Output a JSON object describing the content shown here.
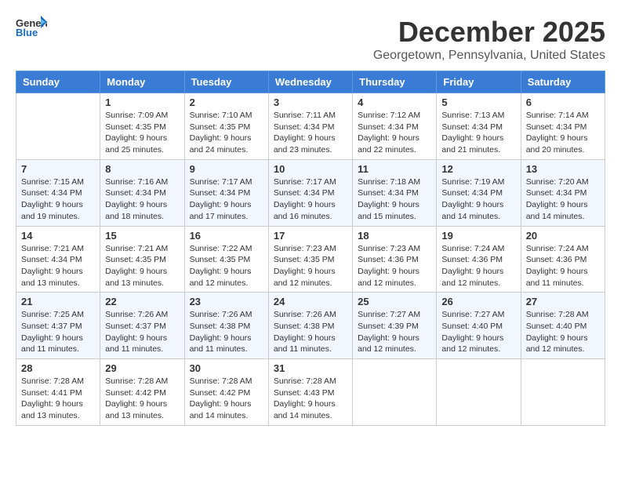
{
  "logo": {
    "general": "General",
    "blue": "Blue"
  },
  "title": "December 2025",
  "location": "Georgetown, Pennsylvania, United States",
  "days_of_week": [
    "Sunday",
    "Monday",
    "Tuesday",
    "Wednesday",
    "Thursday",
    "Friday",
    "Saturday"
  ],
  "weeks": [
    [
      {
        "day": "",
        "sunrise": "",
        "sunset": "",
        "daylight": ""
      },
      {
        "day": "1",
        "sunrise": "Sunrise: 7:09 AM",
        "sunset": "Sunset: 4:35 PM",
        "daylight": "Daylight: 9 hours and 25 minutes."
      },
      {
        "day": "2",
        "sunrise": "Sunrise: 7:10 AM",
        "sunset": "Sunset: 4:35 PM",
        "daylight": "Daylight: 9 hours and 24 minutes."
      },
      {
        "day": "3",
        "sunrise": "Sunrise: 7:11 AM",
        "sunset": "Sunset: 4:34 PM",
        "daylight": "Daylight: 9 hours and 23 minutes."
      },
      {
        "day": "4",
        "sunrise": "Sunrise: 7:12 AM",
        "sunset": "Sunset: 4:34 PM",
        "daylight": "Daylight: 9 hours and 22 minutes."
      },
      {
        "day": "5",
        "sunrise": "Sunrise: 7:13 AM",
        "sunset": "Sunset: 4:34 PM",
        "daylight": "Daylight: 9 hours and 21 minutes."
      },
      {
        "day": "6",
        "sunrise": "Sunrise: 7:14 AM",
        "sunset": "Sunset: 4:34 PM",
        "daylight": "Daylight: 9 hours and 20 minutes."
      }
    ],
    [
      {
        "day": "7",
        "sunrise": "Sunrise: 7:15 AM",
        "sunset": "Sunset: 4:34 PM",
        "daylight": "Daylight: 9 hours and 19 minutes."
      },
      {
        "day": "8",
        "sunrise": "Sunrise: 7:16 AM",
        "sunset": "Sunset: 4:34 PM",
        "daylight": "Daylight: 9 hours and 18 minutes."
      },
      {
        "day": "9",
        "sunrise": "Sunrise: 7:17 AM",
        "sunset": "Sunset: 4:34 PM",
        "daylight": "Daylight: 9 hours and 17 minutes."
      },
      {
        "day": "10",
        "sunrise": "Sunrise: 7:17 AM",
        "sunset": "Sunset: 4:34 PM",
        "daylight": "Daylight: 9 hours and 16 minutes."
      },
      {
        "day": "11",
        "sunrise": "Sunrise: 7:18 AM",
        "sunset": "Sunset: 4:34 PM",
        "daylight": "Daylight: 9 hours and 15 minutes."
      },
      {
        "day": "12",
        "sunrise": "Sunrise: 7:19 AM",
        "sunset": "Sunset: 4:34 PM",
        "daylight": "Daylight: 9 hours and 14 minutes."
      },
      {
        "day": "13",
        "sunrise": "Sunrise: 7:20 AM",
        "sunset": "Sunset: 4:34 PM",
        "daylight": "Daylight: 9 hours and 14 minutes."
      }
    ],
    [
      {
        "day": "14",
        "sunrise": "Sunrise: 7:21 AM",
        "sunset": "Sunset: 4:34 PM",
        "daylight": "Daylight: 9 hours and 13 minutes."
      },
      {
        "day": "15",
        "sunrise": "Sunrise: 7:21 AM",
        "sunset": "Sunset: 4:35 PM",
        "daylight": "Daylight: 9 hours and 13 minutes."
      },
      {
        "day": "16",
        "sunrise": "Sunrise: 7:22 AM",
        "sunset": "Sunset: 4:35 PM",
        "daylight": "Daylight: 9 hours and 12 minutes."
      },
      {
        "day": "17",
        "sunrise": "Sunrise: 7:23 AM",
        "sunset": "Sunset: 4:35 PM",
        "daylight": "Daylight: 9 hours and 12 minutes."
      },
      {
        "day": "18",
        "sunrise": "Sunrise: 7:23 AM",
        "sunset": "Sunset: 4:36 PM",
        "daylight": "Daylight: 9 hours and 12 minutes."
      },
      {
        "day": "19",
        "sunrise": "Sunrise: 7:24 AM",
        "sunset": "Sunset: 4:36 PM",
        "daylight": "Daylight: 9 hours and 12 minutes."
      },
      {
        "day": "20",
        "sunrise": "Sunrise: 7:24 AM",
        "sunset": "Sunset: 4:36 PM",
        "daylight": "Daylight: 9 hours and 11 minutes."
      }
    ],
    [
      {
        "day": "21",
        "sunrise": "Sunrise: 7:25 AM",
        "sunset": "Sunset: 4:37 PM",
        "daylight": "Daylight: 9 hours and 11 minutes."
      },
      {
        "day": "22",
        "sunrise": "Sunrise: 7:26 AM",
        "sunset": "Sunset: 4:37 PM",
        "daylight": "Daylight: 9 hours and 11 minutes."
      },
      {
        "day": "23",
        "sunrise": "Sunrise: 7:26 AM",
        "sunset": "Sunset: 4:38 PM",
        "daylight": "Daylight: 9 hours and 11 minutes."
      },
      {
        "day": "24",
        "sunrise": "Sunrise: 7:26 AM",
        "sunset": "Sunset: 4:38 PM",
        "daylight": "Daylight: 9 hours and 11 minutes."
      },
      {
        "day": "25",
        "sunrise": "Sunrise: 7:27 AM",
        "sunset": "Sunset: 4:39 PM",
        "daylight": "Daylight: 9 hours and 12 minutes."
      },
      {
        "day": "26",
        "sunrise": "Sunrise: 7:27 AM",
        "sunset": "Sunset: 4:40 PM",
        "daylight": "Daylight: 9 hours and 12 minutes."
      },
      {
        "day": "27",
        "sunrise": "Sunrise: 7:28 AM",
        "sunset": "Sunset: 4:40 PM",
        "daylight": "Daylight: 9 hours and 12 minutes."
      }
    ],
    [
      {
        "day": "28",
        "sunrise": "Sunrise: 7:28 AM",
        "sunset": "Sunset: 4:41 PM",
        "daylight": "Daylight: 9 hours and 13 minutes."
      },
      {
        "day": "29",
        "sunrise": "Sunrise: 7:28 AM",
        "sunset": "Sunset: 4:42 PM",
        "daylight": "Daylight: 9 hours and 13 minutes."
      },
      {
        "day": "30",
        "sunrise": "Sunrise: 7:28 AM",
        "sunset": "Sunset: 4:42 PM",
        "daylight": "Daylight: 9 hours and 14 minutes."
      },
      {
        "day": "31",
        "sunrise": "Sunrise: 7:28 AM",
        "sunset": "Sunset: 4:43 PM",
        "daylight": "Daylight: 9 hours and 14 minutes."
      },
      {
        "day": "",
        "sunrise": "",
        "sunset": "",
        "daylight": ""
      },
      {
        "day": "",
        "sunrise": "",
        "sunset": "",
        "daylight": ""
      },
      {
        "day": "",
        "sunrise": "",
        "sunset": "",
        "daylight": ""
      }
    ]
  ]
}
